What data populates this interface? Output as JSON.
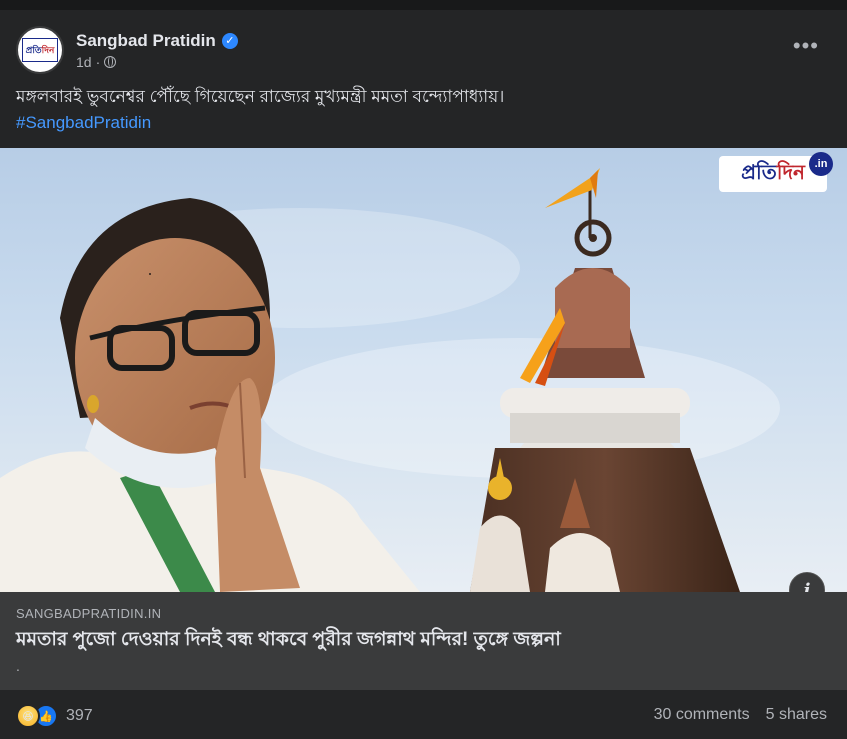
{
  "post": {
    "page_name": "Sangbad Pratidin",
    "avatar_text_a": "প্রতি",
    "avatar_text_b": "দিন",
    "verified_icon": "verified-badge-icon",
    "time": "1d",
    "audience_icon": "globe-icon",
    "more_label": "•••",
    "caption": "মঙ্গলবারই ভুবনেশ্বর পৌঁছে গিয়েছেন রাজ্যের মুখ্যমন্ত্রী মমতা বন্দ্যোপাধ্যায়।",
    "hashtag": "#SangbadPratidin"
  },
  "image": {
    "watermark_a": "প্রতি",
    "watermark_b": "দিন",
    "watermark_suffix": ".in",
    "info_label": "i"
  },
  "link": {
    "domain": "SANGBADPRATIDIN.IN",
    "title": "মমতার পুজো দেওয়ার দিনই বন্ধ থাকবে পুরীর জগন্নাথ মন্দির! তুঙ্গে জল্পনা",
    "description": "."
  },
  "stats": {
    "reaction_icons": [
      "haha-icon",
      "like-icon"
    ],
    "reaction_count": "397",
    "comments": "30 comments",
    "shares": "5 shares"
  },
  "colors": {
    "background": "#242526",
    "link_box": "#3a3b3c",
    "hashtag": "#4599ff",
    "verified": "#2d88ff"
  }
}
